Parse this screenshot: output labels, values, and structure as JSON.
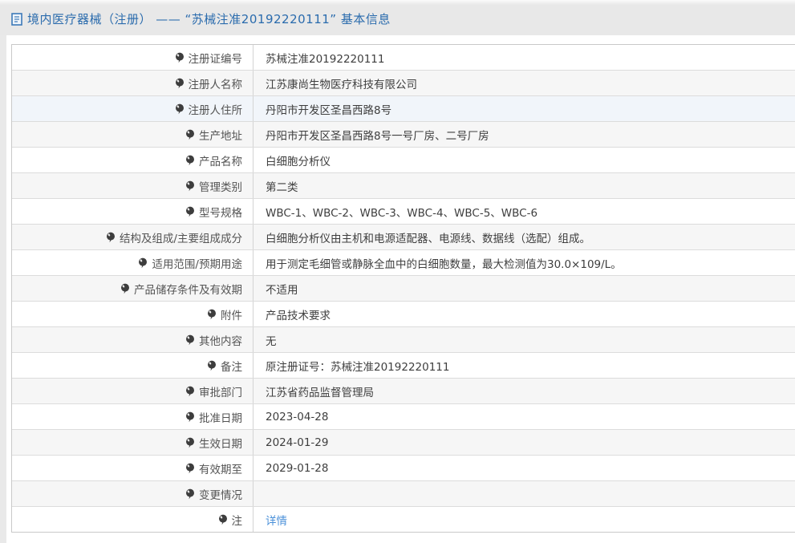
{
  "header": {
    "title": "境内医疗器械（注册） —— “苏械注准20192220111” 基本信息",
    "icon": "document-icon"
  },
  "colors": {
    "header_bar_bg": "#e8e8e8",
    "header_text": "#2a6bad",
    "link_blue": "#4a90d9",
    "row_alt_bg": "#f6f6f6",
    "row_hover_bg": "#f1f5fa",
    "border": "#c9c9c9"
  },
  "table": {
    "rows": [
      {
        "label": "注册证编号",
        "value": "苏械注准20192220111"
      },
      {
        "label": "注册人名称",
        "value": "江苏康尚生物医疗科技有限公司"
      },
      {
        "label": "注册人住所",
        "value": "丹阳市开发区圣昌西路8号",
        "hover": true
      },
      {
        "label": "生产地址",
        "value": "丹阳市开发区圣昌西路8号一号厂房、二号厂房"
      },
      {
        "label": "产品名称",
        "value": "白细胞分析仪"
      },
      {
        "label": "管理类别",
        "value": "第二类"
      },
      {
        "label": "型号规格",
        "value": "WBC-1、WBC-2、WBC-3、WBC-4、WBC-5、WBC-6"
      },
      {
        "label": "结构及组成/主要组成成分",
        "value": "白细胞分析仪由主机和电源适配器、电源线、数据线（选配）组成。"
      },
      {
        "label": "适用范围/预期用途",
        "value": "用于测定毛细管或静脉全血中的白细胞数量，最大检测值为30.0×109/L。"
      },
      {
        "label": "产品储存条件及有效期",
        "value": "不适用"
      },
      {
        "label": "附件",
        "value": "产品技术要求"
      },
      {
        "label": "其他内容",
        "value": "无"
      },
      {
        "label": "备注",
        "value": "原注册证号：苏械注准20192220111"
      },
      {
        "label": "审批部门",
        "value": "江苏省药品监督管理局"
      },
      {
        "label": "批准日期",
        "value": "2023-04-28"
      },
      {
        "label": "生效日期",
        "value": "2024-01-29"
      },
      {
        "label": "有效期至",
        "value": "2029-01-28"
      },
      {
        "label": "变更情况",
        "value": ""
      },
      {
        "label": "注",
        "value": "详情",
        "link": true,
        "icon": "balloon-icon"
      }
    ]
  }
}
